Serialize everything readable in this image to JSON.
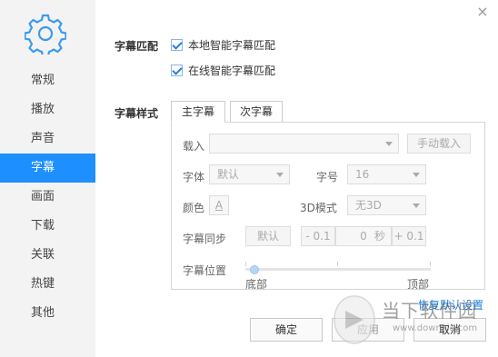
{
  "sidebar": {
    "items": [
      {
        "label": "常规"
      },
      {
        "label": "播放"
      },
      {
        "label": "声音"
      },
      {
        "label": "字幕",
        "active": true
      },
      {
        "label": "画面"
      },
      {
        "label": "下载"
      },
      {
        "label": "关联"
      },
      {
        "label": "热键"
      },
      {
        "label": "其他"
      }
    ]
  },
  "match": {
    "label": "字幕匹配",
    "local_label": "本地智能字幕匹配",
    "local_checked": true,
    "online_label": "在线智能字幕匹配",
    "online_checked": true
  },
  "style": {
    "label": "字幕样式",
    "tabs": [
      {
        "label": "主字幕",
        "active": true
      },
      {
        "label": "次字幕"
      }
    ],
    "load_label": "载入",
    "load_value": "",
    "manual_load_button": "手动载入",
    "font_label": "字体",
    "font_value": "默认",
    "size_label": "字号",
    "size_value": "16",
    "color_label": "颜色",
    "color_glyph": "A",
    "mode3d_label": "3D模式",
    "mode3d_value": "无3D",
    "sync_label": "字幕同步",
    "sync_default_button": "默认",
    "sync_minus": "- 0.1",
    "sync_value": "0",
    "sync_unit": "秒",
    "sync_plus": "+ 0.1",
    "position_label": "字幕位置",
    "position_min": "底部",
    "position_max": "顶部",
    "position_value": 0.05
  },
  "restore_link": "恢复默认设置",
  "buttons": {
    "ok": "确定",
    "apply": "应用",
    "cancel": "取消"
  },
  "watermark": {
    "title": "当下软件园",
    "url": "www.downxia.com"
  },
  "colors": {
    "accent": "#1e8fff",
    "link": "#1e7fe0"
  }
}
